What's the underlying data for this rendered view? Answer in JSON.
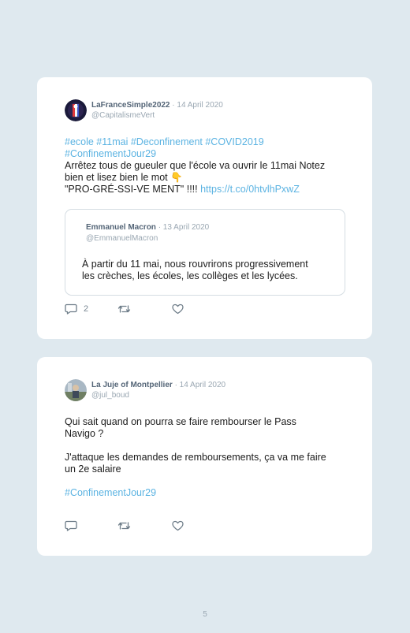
{
  "tweets": [
    {
      "author": "LaFranceSimple2022",
      "date": "· 14 April 2020",
      "handle": "@CapitalismeVert",
      "text": {
        "hashtags1": "#ecole #11mai #Deconfinement #COVID2019",
        "hashtags2": "#ConfinementJour29",
        "line3": "Arrêtez tous de gueuler que l'école va ouvrir le 11mai Notez",
        "line4": "bien et lisez bien le mot 👇",
        "line5": "\"PRO-GRÉ-SSI-VE MENT\" !!!! ",
        "link": "https://t.co/0htvlhPxwZ"
      },
      "quote": {
        "author": "Emmanuel Macron",
        "date": "· 13 April 2020",
        "handle": "@EmmanuelMacron",
        "line1": "À partir du 11 mai, nous rouvrirons progressivement",
        "line2": "les crèches, les écoles, les collèges et les lycées."
      },
      "reply_count": "2"
    },
    {
      "author": "La Juje of Montpellier",
      "date": "· 14 April 2020",
      "handle": "@jul_boud",
      "text": {
        "line1": "Qui sait quand on pourra se faire rembourser le Pass",
        "line2": "Navigo ?",
        "line3": "J'attaque les demandes de remboursements, ça va me faire",
        "line4": "un 2e salaire",
        "hashtag": "#ConfinementJour29"
      }
    }
  ],
  "icons": [
    "reply-icon",
    "retweet-icon",
    "like-icon"
  ],
  "page_number": "5"
}
